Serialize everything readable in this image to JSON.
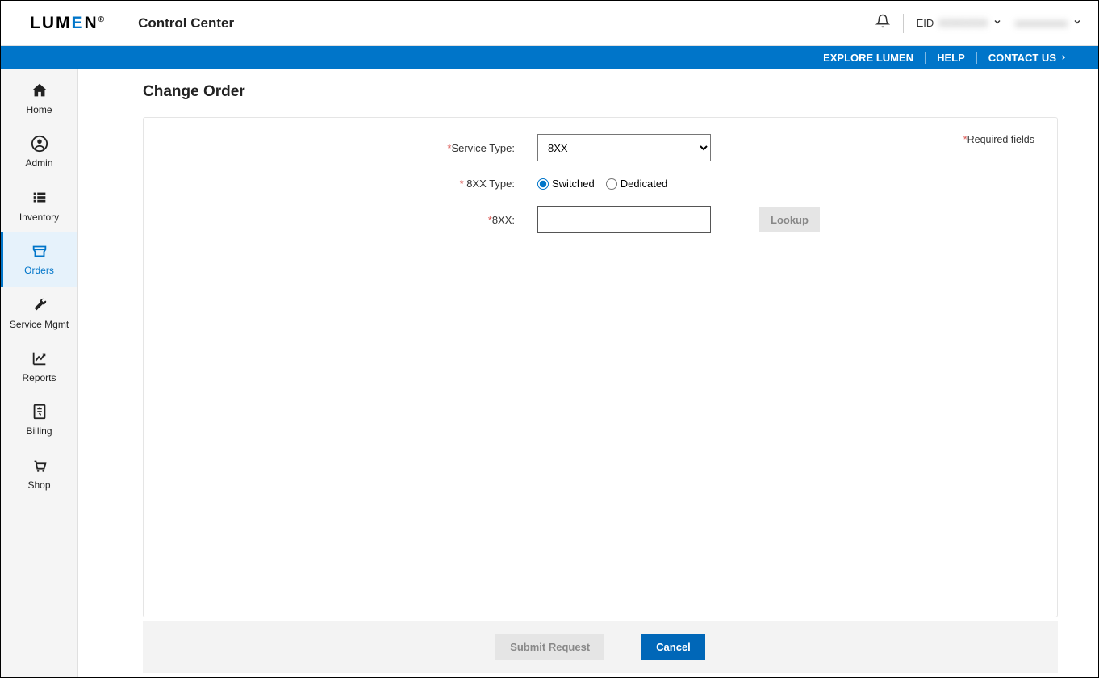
{
  "header": {
    "logo_plain": "LUMEN",
    "app_title": "Control Center",
    "eid_label": "EID",
    "eid_value": "XXXXXXX",
    "username": "xxxxxxxxxx"
  },
  "bluebar": {
    "explore": "EXPLORE LUMEN",
    "help": "HELP",
    "contact": "CONTACT US"
  },
  "sidebar": {
    "items": [
      {
        "id": "home",
        "label": "Home"
      },
      {
        "id": "admin",
        "label": "Admin"
      },
      {
        "id": "inventory",
        "label": "Inventory"
      },
      {
        "id": "orders",
        "label": "Orders"
      },
      {
        "id": "service-mgmt",
        "label": "Service Mgmt"
      },
      {
        "id": "reports",
        "label": "Reports"
      },
      {
        "id": "billing",
        "label": "Billing"
      },
      {
        "id": "shop",
        "label": "Shop"
      }
    ],
    "active": "orders"
  },
  "page": {
    "title": "Change Order",
    "required_label": "Required fields"
  },
  "form": {
    "service_type_label": "Service Type:",
    "service_type_value": "8XX",
    "type_label": " 8XX Type:",
    "type_options": {
      "switched": "Switched",
      "dedicated": "Dedicated"
    },
    "type_selected": "switched",
    "number_label": "8XX:",
    "number_value": "",
    "lookup": "Lookup"
  },
  "footer": {
    "submit": "Submit Request",
    "cancel": "Cancel"
  }
}
